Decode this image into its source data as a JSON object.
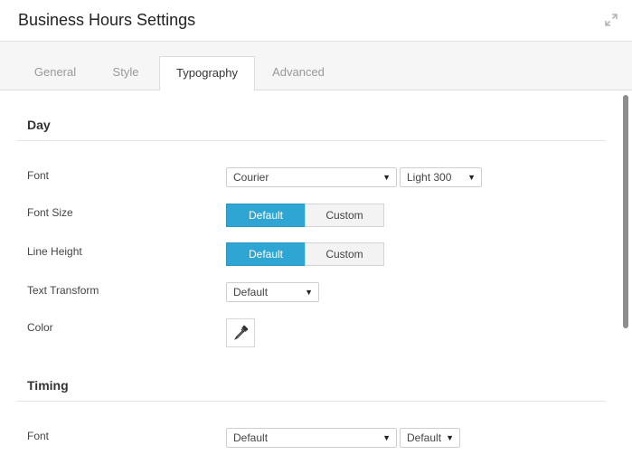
{
  "header": {
    "title": "Business Hours Settings",
    "expand_icon": "expand-icon"
  },
  "tabs": [
    {
      "label": "General",
      "active": false
    },
    {
      "label": "Style",
      "active": false
    },
    {
      "label": "Typography",
      "active": true
    },
    {
      "label": "Advanced",
      "active": false
    }
  ],
  "sections": {
    "day": {
      "title": "Day",
      "font": {
        "label": "Font",
        "family": "Courier",
        "weight": "Light 300"
      },
      "font_size": {
        "label": "Font Size",
        "options": [
          "Default",
          "Custom"
        ],
        "selected": "Default"
      },
      "line_height": {
        "label": "Line Height",
        "options": [
          "Default",
          "Custom"
        ],
        "selected": "Default"
      },
      "text_transform": {
        "label": "Text Transform",
        "value": "Default"
      },
      "color": {
        "label": "Color",
        "icon": "eyedropper-icon"
      }
    },
    "timing": {
      "title": "Timing",
      "font": {
        "label": "Font",
        "family": "Default",
        "weight": "Default"
      }
    }
  },
  "colors": {
    "accent": "#2ea5d3",
    "toggle_off": "#f3f3f3",
    "tab_bar": "#f6f6f6"
  }
}
